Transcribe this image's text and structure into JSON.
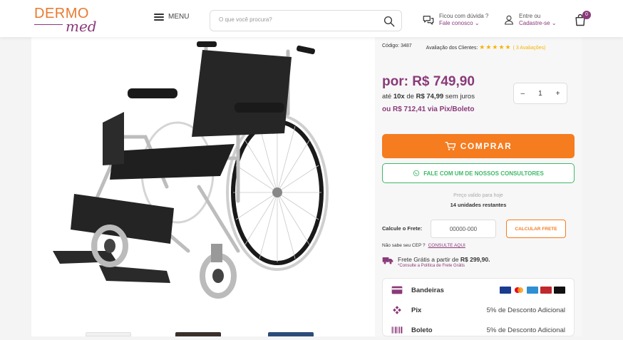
{
  "header": {
    "logo_top": "DERMO",
    "logo_bottom": "med",
    "menu_label": "MENU",
    "search_placeholder": "O que você procura?",
    "help_line1": "Ficou com dúvida ?",
    "help_line2": "Fale conosco",
    "account_line1": "Entre ou",
    "account_line2": "Cadastre-se",
    "cart_count": "0"
  },
  "product": {
    "code": "Código: 3487",
    "reviews_label": "Avaliação dos Clientes:",
    "stars": "★★★★★",
    "reviews_count": "( 3 Avaliações)",
    "price": "por: R$ 749,90",
    "installments_prefix": "até ",
    "installments_count": "10x",
    "installments_mid": " de ",
    "installments_value": "R$ 74,99",
    "installments_suffix": " sem juros",
    "pix_price": "ou R$ 712,41 via Pix/Boleto",
    "quantity": "1",
    "qty_minus": "–",
    "qty_plus": "+",
    "buy_label": "COMPRAR",
    "consult_label": "FALE COM UM DE NOSSOS CONSULTORES",
    "valid_label": "Preço valido para hoje",
    "units_left": "14 unidades restantes"
  },
  "shipping": {
    "label": "Calcule o Frete:",
    "cep_value": "00000-000",
    "calc_label": "CALCULAR FRETE",
    "no_cep": "Não sabe seu CEP ?",
    "consult_link": "CONSULTE AQUI",
    "free_prefix": "Frete Grátis a partir de ",
    "free_value": "R$ 299,90.",
    "free_note": "*Consulte a Política de Frete Grátis"
  },
  "payment": {
    "rows": [
      {
        "label": "Bandeiras",
        "right": ""
      },
      {
        "label": "Pix",
        "right": "5% de Desconto Adicional"
      },
      {
        "label": "Boleto",
        "right": "5% de Desconto Adicional"
      }
    ]
  },
  "colors": {
    "brand_purple": "#8a3a7a",
    "brand_orange": "#f57c1f",
    "consult_green": "#3fb86a"
  }
}
